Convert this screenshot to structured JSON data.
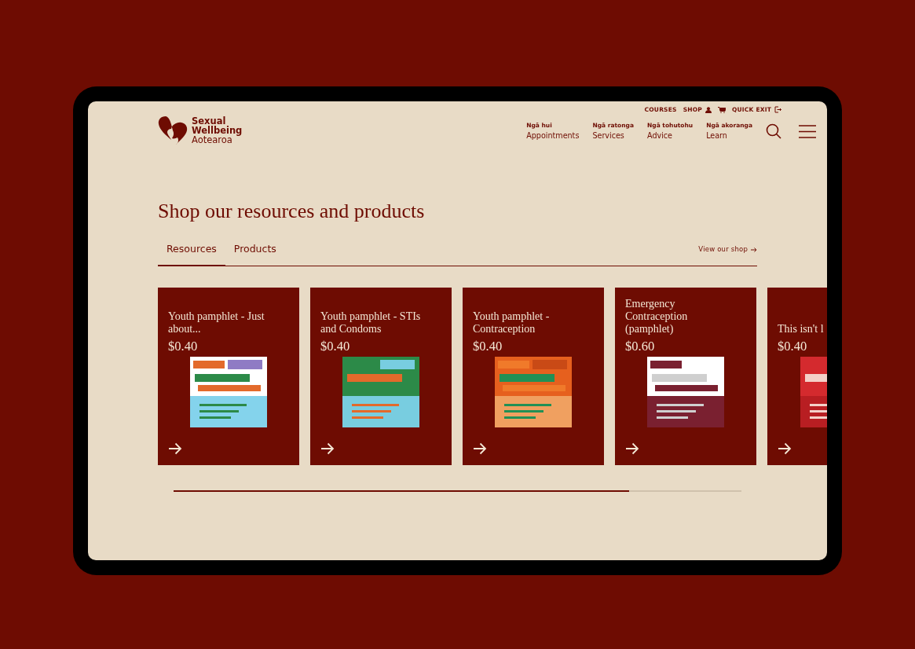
{
  "logo": {
    "lines": [
      "Sexual",
      "Wellbeing",
      "Aotearoa"
    ]
  },
  "utility_links": [
    {
      "label": "COURSES",
      "kind": "text"
    },
    {
      "label": "SHOP",
      "kind": "account"
    },
    {
      "label": "QUICK EXIT",
      "kind": "exit"
    }
  ],
  "nav": [
    {
      "sub": "Ngā hui",
      "label": "Appointments"
    },
    {
      "sub": "Ngā ratonga",
      "label": "Services"
    },
    {
      "sub": "Ngā tohutohu",
      "label": "Advice"
    },
    {
      "sub": "Ngā akoranga",
      "label": "Learn"
    }
  ],
  "title": "Shop our resources and products",
  "tabs": [
    {
      "label": "Resources",
      "selected": true
    },
    {
      "label": "Products",
      "selected": false
    }
  ],
  "view_shop": "View our shop",
  "products": [
    {
      "title": "Youth pamphlet - Just about...",
      "price": "$0.40"
    },
    {
      "title": "Youth pamphlet - STIs and Condoms",
      "price": "$0.40"
    },
    {
      "title": "Youth pamphlet - Contraception",
      "price": "$0.40"
    },
    {
      "title": "Emergency Contraception (pamphlet)",
      "price": "$0.60"
    },
    {
      "title": "This isn't l",
      "price": "$0.40"
    }
  ]
}
